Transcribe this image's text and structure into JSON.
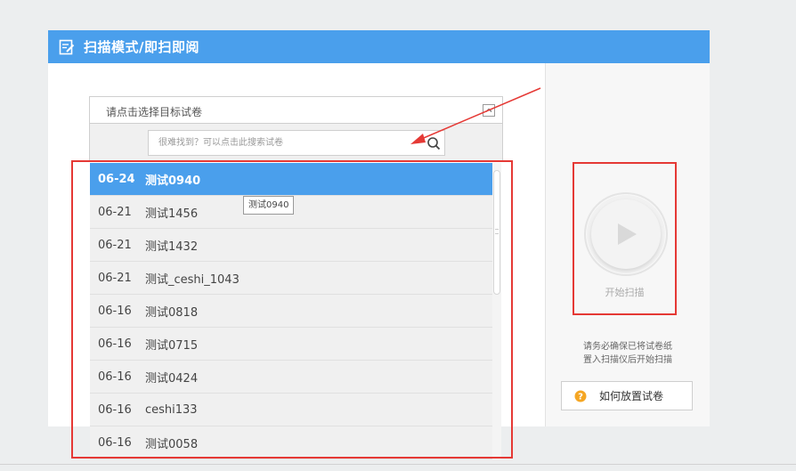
{
  "header": {
    "title": "扫描模式/即扫即阅",
    "icon": "edit-icon",
    "color": "#4a9fec"
  },
  "paper_select": {
    "placeholder": "请点击选择目标试卷",
    "search_placeholder": "很难找到？可以点击此搜索试卷"
  },
  "papers": [
    {
      "date": "06-24",
      "name": "测试0940",
      "selected": true
    },
    {
      "date": "06-21",
      "name": "测试1456"
    },
    {
      "date": "06-21",
      "name": "测试1432"
    },
    {
      "date": "06-21",
      "name": "测试_ceshi_1043"
    },
    {
      "date": "06-16",
      "name": "测试0818"
    },
    {
      "date": "06-16",
      "name": "测试0715"
    },
    {
      "date": "06-16",
      "name": "测试0424"
    },
    {
      "date": "06-16",
      "name": "ceshi133"
    },
    {
      "date": "06-16",
      "name": "测试0058"
    }
  ],
  "tooltip": "测试0940",
  "scan": {
    "start_label": "开始扫描",
    "hint_line1": "请务必确保已将试卷纸",
    "hint_line2": "置入扫描仪后开始扫描",
    "howto_label": "如何放置试卷"
  },
  "annotation_color": "#e53935"
}
